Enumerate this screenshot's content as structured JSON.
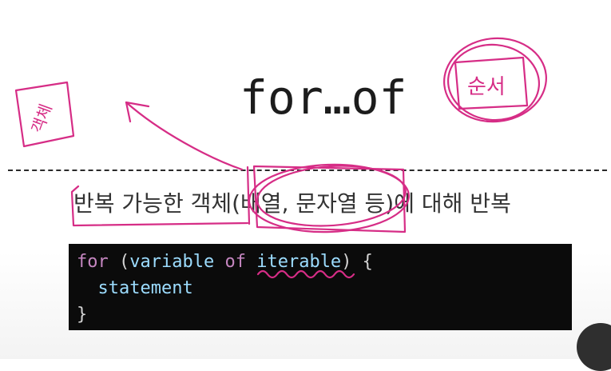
{
  "slide": {
    "title": "for…of",
    "description": "반복 가능한 객체(배열, 문자열 등)에 대해 반복"
  },
  "code": {
    "line1": {
      "kw_for": "for",
      "open": " (",
      "var": "variable",
      "space1": " ",
      "kw_of": "of",
      "space2": " ",
      "iter": "iterable",
      "close": ") {"
    },
    "line2": "  statement",
    "line3": "}"
  },
  "annotations": {
    "handwritten_left": "객체",
    "handwritten_right": "순서",
    "ink_color": "#d62d86"
  }
}
